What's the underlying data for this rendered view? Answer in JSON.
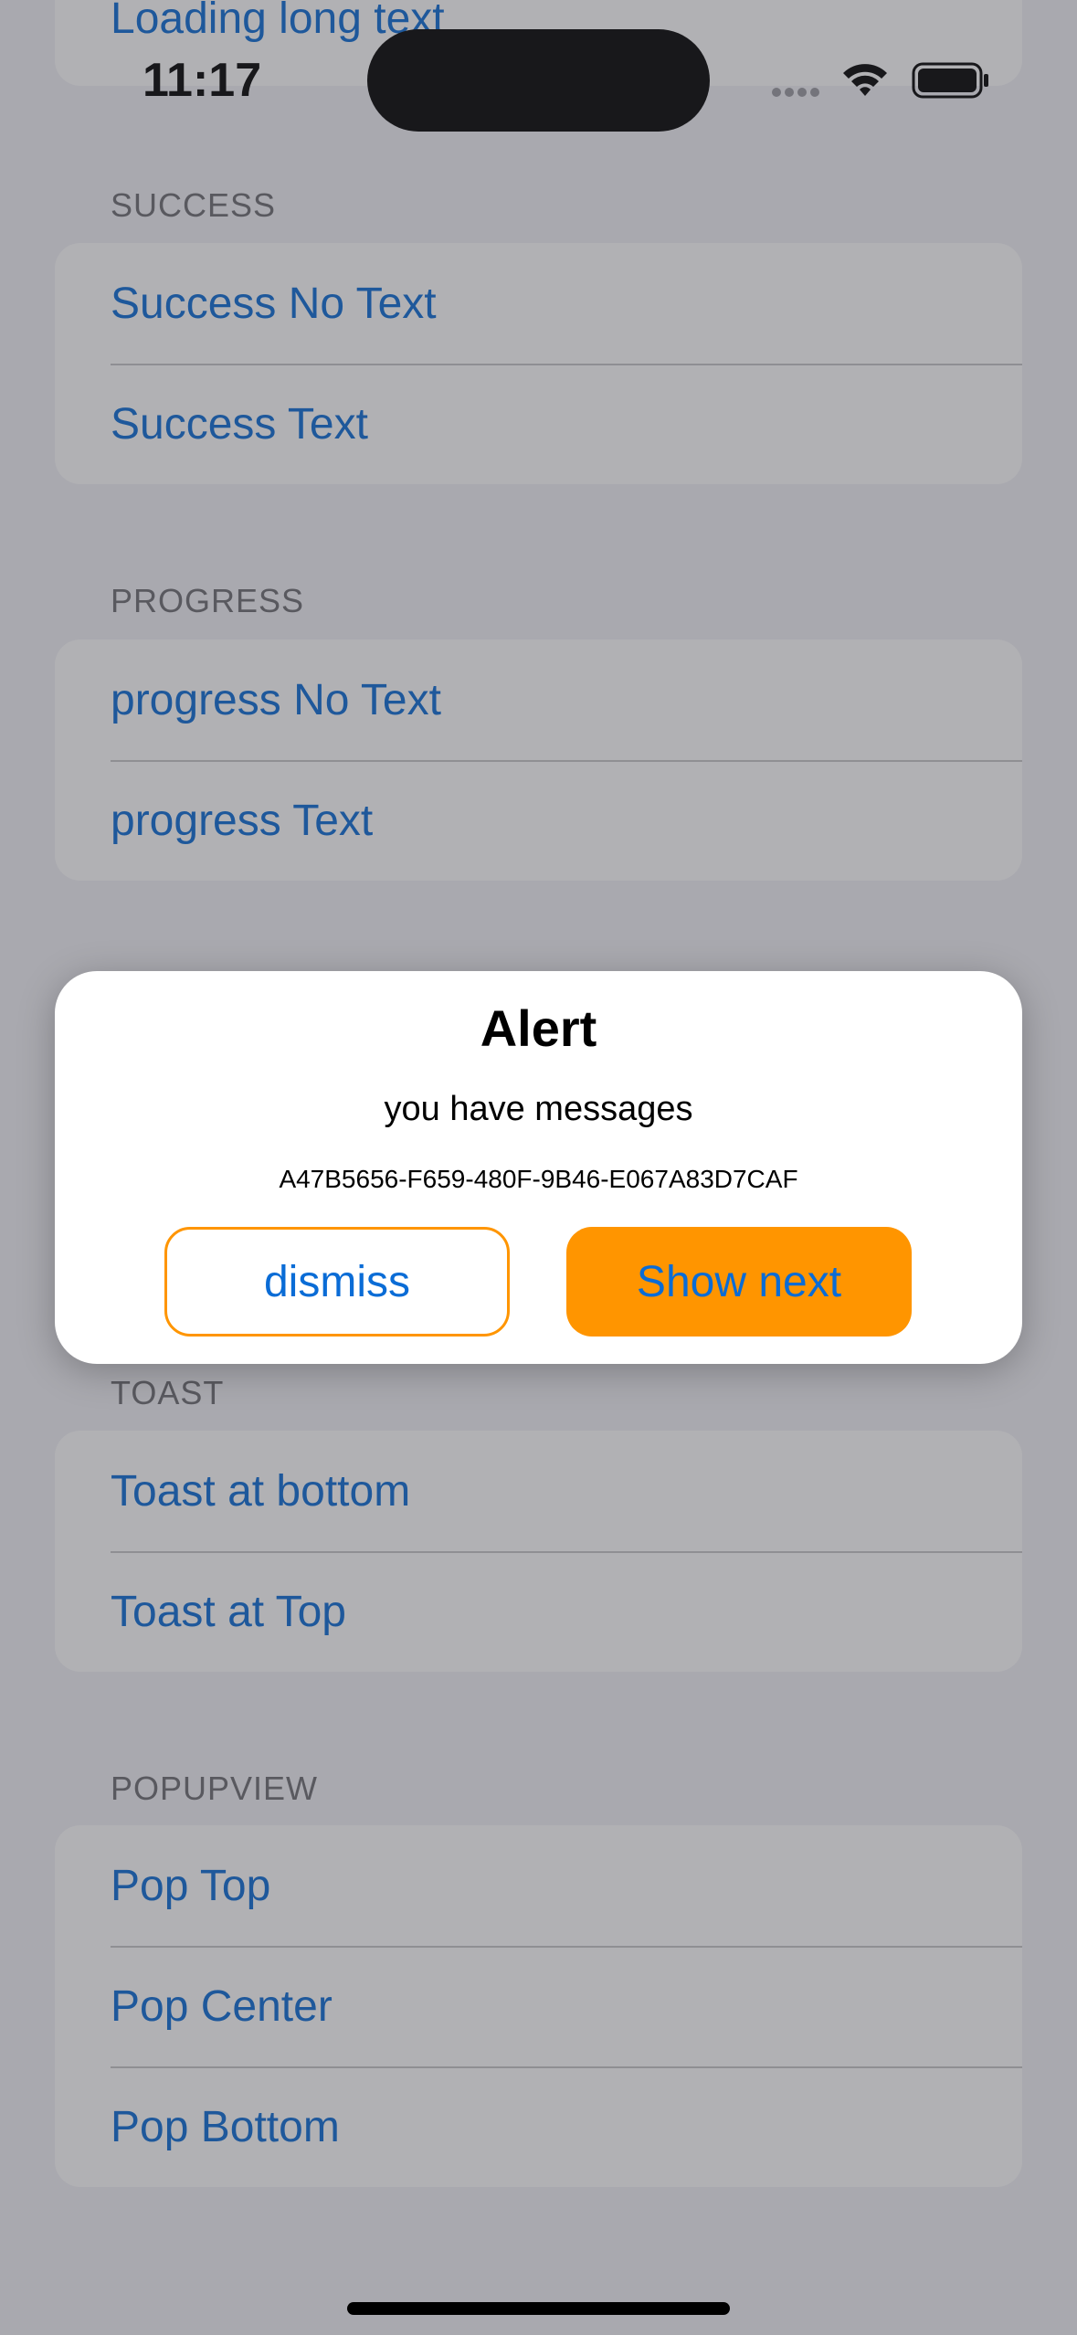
{
  "status_bar": {
    "time": "11:17"
  },
  "sections": {
    "top_partial": {
      "items": [
        "Loading long text"
      ]
    },
    "success": {
      "header": "SUCCESS",
      "items": [
        "Success No Text",
        "Success Text"
      ]
    },
    "progress": {
      "header": "PROGRESS",
      "items": [
        "progress No Text",
        "progress Text"
      ]
    },
    "toast": {
      "header": "TOAST",
      "items": [
        "Toast at bottom",
        "Toast at Top"
      ]
    },
    "popupview": {
      "header": "POPUPVIEW",
      "items": [
        "Pop Top",
        "Pop Center",
        "Pop Bottom"
      ]
    }
  },
  "alert": {
    "title": "Alert",
    "message": "you have messages",
    "id": "A47B5656-F659-480F-9B46-E067A83D7CAF",
    "dismiss_label": "dismiss",
    "next_label": "Show next"
  },
  "colors": {
    "link": "#0a6cd6",
    "accent": "#ff9500",
    "background": "#f2f2f7"
  },
  "icons": [
    "signal-icon",
    "wifi-icon",
    "battery-icon"
  ]
}
